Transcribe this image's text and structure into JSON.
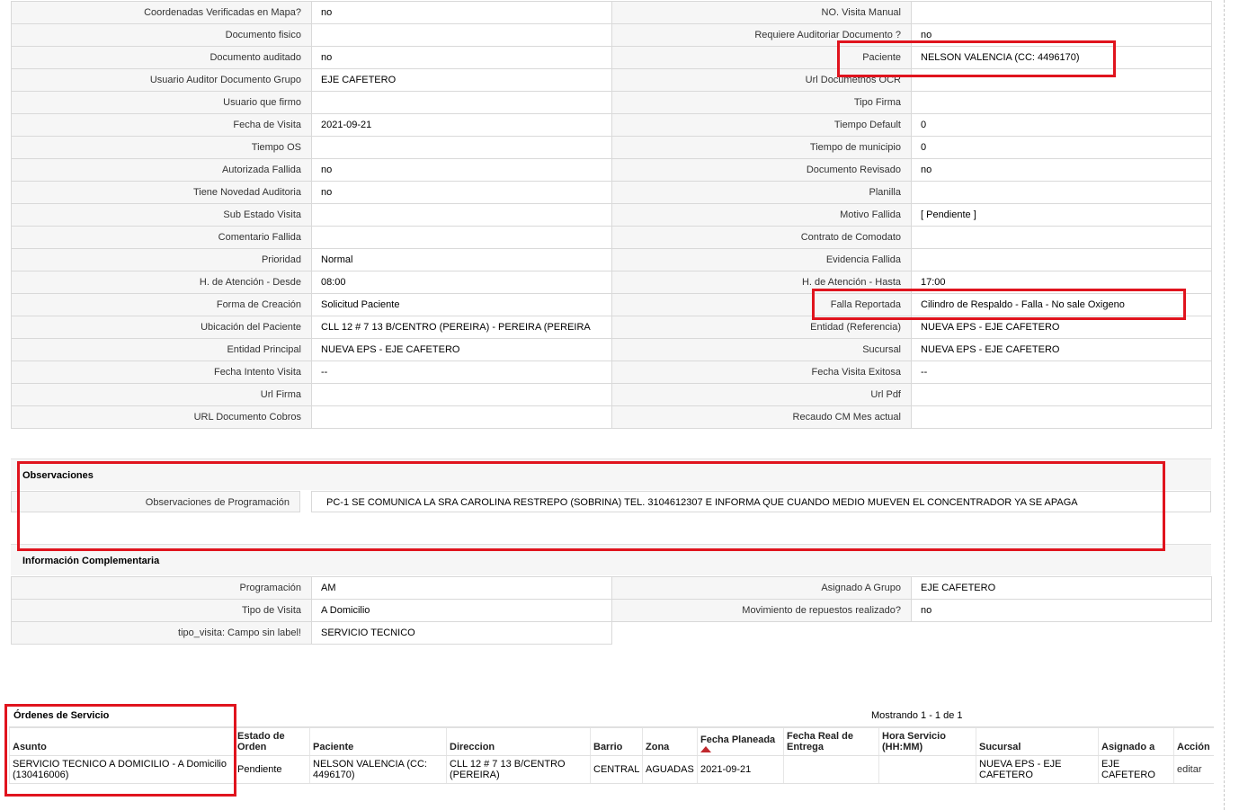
{
  "detail_rows": [
    [
      "Coordenadas Verificadas en Mapa?",
      "no",
      "NO. Visita Manual",
      ""
    ],
    [
      "Documento fisico",
      "",
      "Requiere Auditoriar Documento ?",
      "no"
    ],
    [
      "Documento auditado",
      "no",
      "Paciente",
      "NELSON VALENCIA (CC: 4496170)"
    ],
    [
      "Usuario Auditor Documento Grupo",
      "EJE CAFETERO",
      "Url Documetnos OCR",
      ""
    ],
    [
      "Usuario que firmo",
      "",
      "Tipo Firma",
      ""
    ],
    [
      "Fecha de Visita",
      "2021-09-21",
      "Tiempo Default",
      "0"
    ],
    [
      "Tiempo OS",
      "",
      "Tiempo de municipio",
      "0"
    ],
    [
      "Autorizada Fallida",
      "no",
      "Documento Revisado",
      "no"
    ],
    [
      "Tiene Novedad Auditoria",
      "no",
      "Planilla",
      ""
    ],
    [
      "Sub Estado Visita",
      "",
      "Motivo Fallida",
      "[ Pendiente ]"
    ],
    [
      "Comentario Fallida",
      "",
      "Contrato de Comodato",
      ""
    ],
    [
      "Prioridad",
      "Normal",
      "Evidencia Fallida",
      ""
    ],
    [
      "H. de Atención - Desde",
      "08:00",
      "H. de Atención - Hasta",
      "17:00"
    ],
    [
      "Forma de Creación",
      "Solicitud Paciente",
      "Falla Reportada",
      "Cilindro de Respaldo - Falla - No sale Oxigeno"
    ],
    [
      "Ubicación del Paciente",
      "CLL 12 # 7 13 B/CENTRO (PEREIRA) - PEREIRA (PEREIRA",
      "Entidad (Referencia)",
      "NUEVA EPS - EJE CAFETERO"
    ],
    [
      "Entidad Principal",
      "NUEVA EPS - EJE CAFETERO",
      "Sucursal",
      "NUEVA EPS - EJE CAFETERO"
    ],
    [
      "Fecha Intento Visita",
      "--",
      "Fecha Visita Exitosa",
      "--"
    ],
    [
      "Url Firma",
      "",
      "Url Pdf",
      ""
    ],
    [
      "URL Documento Cobros",
      "",
      "Recaudo CM Mes actual",
      ""
    ]
  ],
  "observaciones": {
    "title": "Observaciones",
    "label": "Observaciones de Programación",
    "value": "PC-1 SE COMUNICA LA SRA CAROLINA RESTREPO (SOBRINA) TEL. 3104612307 E INFORMA QUE CUANDO MEDIO MUEVEN EL CONCENTRADOR YA SE APAGA"
  },
  "complementaria": {
    "title": "Información Complementaria",
    "rows": [
      [
        "Programación",
        "AM",
        "Asignado A Grupo",
        "EJE CAFETERO"
      ],
      [
        "Tipo de Visita",
        "A Domicilio",
        "Movimiento de repuestos realizado?",
        "no"
      ],
      [
        "tipo_visita: Campo sin label!",
        "SERVICIO TECNICO"
      ]
    ]
  },
  "orders": {
    "title": "Órdenes de Servicio",
    "pagination": "Mostrando 1 - 1 de 1",
    "columns": [
      "Asunto",
      "Estado de Orden",
      "Paciente",
      "Direccion",
      "Barrio",
      "Zona",
      "Fecha Planeada",
      "Fecha Real de Entrega",
      "Hora Servicio (HH:MM)",
      "Sucursal",
      "Asignado a",
      "Acción"
    ],
    "rows": [
      [
        "SERVICIO TECNICO A DOMICILIO - A Domicilio (130416006)",
        "Pendiente",
        "NELSON VALENCIA (CC: 4496170)",
        "CLL 12 # 7 13 B/CENTRO (PEREIRA)",
        "CENTRAL",
        "AGUADAS",
        "2021-09-21",
        "",
        "",
        "NUEVA EPS - EJE CAFETERO",
        "EJE CAFETERO",
        "editar"
      ]
    ]
  },
  "colors": {
    "highlight": "#e0141e",
    "label_bg": "#f6f6f6",
    "border": "#d9d9d9"
  },
  "icons": {
    "sort": "sort-asc-icon"
  }
}
